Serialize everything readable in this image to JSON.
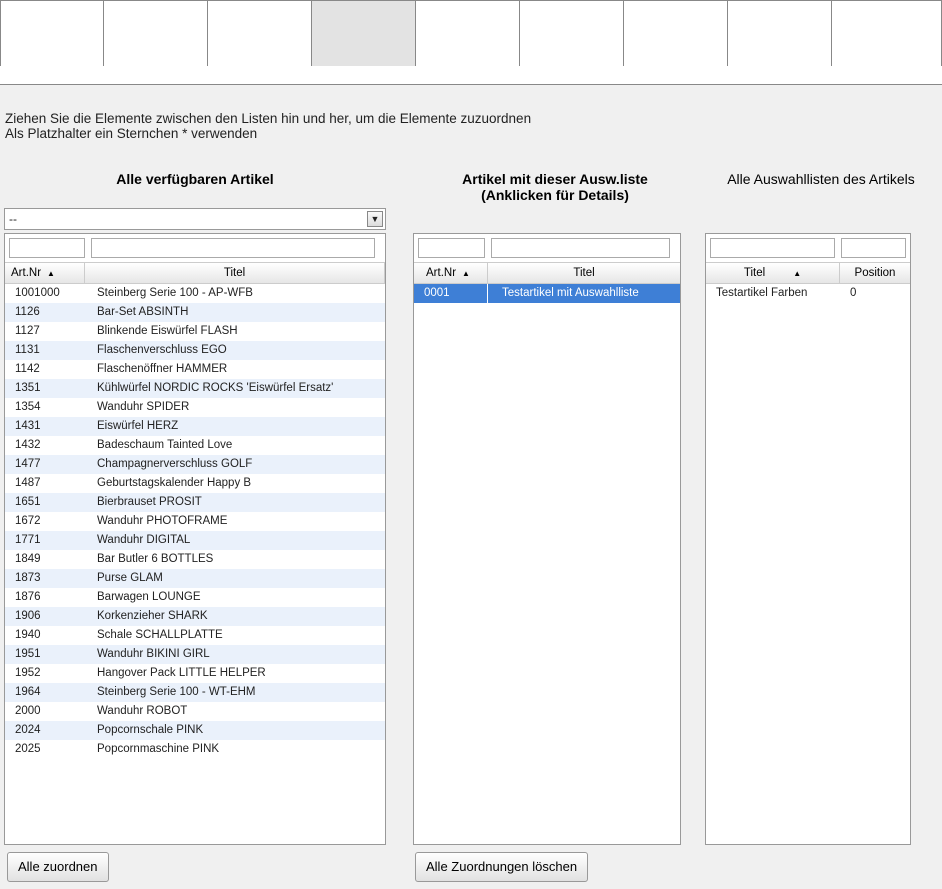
{
  "instructions": {
    "line1": "Ziehen Sie die Elemente zwischen den Listen hin und her, um die Elemente zuzuordnen",
    "line2": "Als Platzhalter ein Sternchen * verwenden"
  },
  "left": {
    "heading": "Alle verfügbaren Artikel",
    "select_value": "--",
    "columns": [
      "Art.Nr",
      "Titel"
    ],
    "rows": [
      {
        "nr": "1001000",
        "titel": "Steinberg Serie 100 - AP-WFB"
      },
      {
        "nr": "1126",
        "titel": "Bar-Set ABSINTH"
      },
      {
        "nr": "1127",
        "titel": "Blinkende Eiswürfel FLASH"
      },
      {
        "nr": "1131",
        "titel": "Flaschenverschluss EGO"
      },
      {
        "nr": "1142",
        "titel": "Flaschenöffner HAMMER"
      },
      {
        "nr": "1351",
        "titel": "Kühlwürfel NORDIC ROCKS 'Eiswürfel Ersatz'"
      },
      {
        "nr": "1354",
        "titel": "Wanduhr SPIDER"
      },
      {
        "nr": "1431",
        "titel": "Eiswürfel HERZ"
      },
      {
        "nr": "1432",
        "titel": "Badeschaum Tainted Love"
      },
      {
        "nr": "1477",
        "titel": "Champagnerverschluss GOLF"
      },
      {
        "nr": "1487",
        "titel": "Geburtstagskalender Happy B"
      },
      {
        "nr": "1651",
        "titel": "Bierbrauset PROSIT"
      },
      {
        "nr": "1672",
        "titel": "Wanduhr PHOTOFRAME"
      },
      {
        "nr": "1771",
        "titel": "Wanduhr DIGITAL"
      },
      {
        "nr": "1849",
        "titel": "Bar Butler 6 BOTTLES"
      },
      {
        "nr": "1873",
        "titel": "Purse GLAM"
      },
      {
        "nr": "1876",
        "titel": "Barwagen LOUNGE"
      },
      {
        "nr": "1906",
        "titel": "Korkenzieher SHARK"
      },
      {
        "nr": "1940",
        "titel": "Schale SCHALLPLATTE"
      },
      {
        "nr": "1951",
        "titel": "Wanduhr BIKINI GIRL"
      },
      {
        "nr": "1952",
        "titel": "Hangover Pack LITTLE HELPER"
      },
      {
        "nr": "1964",
        "titel": "Steinberg Serie 100 - WT-EHM"
      },
      {
        "nr": "2000",
        "titel": "Wanduhr ROBOT"
      },
      {
        "nr": "2024",
        "titel": "Popcornschale PINK"
      },
      {
        "nr": "2025",
        "titel": "Popcornmaschine PINK"
      }
    ],
    "button": "Alle zuordnen"
  },
  "middle": {
    "heading_line1": "Artikel mit dieser Ausw.liste",
    "heading_line2": "(Anklicken für Details)",
    "columns": [
      "Art.Nr",
      "Titel"
    ],
    "rows": [
      {
        "nr": "0001",
        "titel": "Testartikel mit Auswahlliste",
        "selected": true
      }
    ],
    "button": "Alle Zuordnungen löschen"
  },
  "right": {
    "heading": "Alle Auswahllisten des Artikels",
    "columns": [
      "Titel",
      "Position"
    ],
    "rows": [
      {
        "titel": "Testartikel Farben",
        "position": "0"
      }
    ]
  },
  "colors": {
    "selection": "#3e7fd6",
    "alt_row": "#eaf1fb",
    "panel_bg": "#f0f0f0",
    "active_tab": "#e3e3e3"
  }
}
